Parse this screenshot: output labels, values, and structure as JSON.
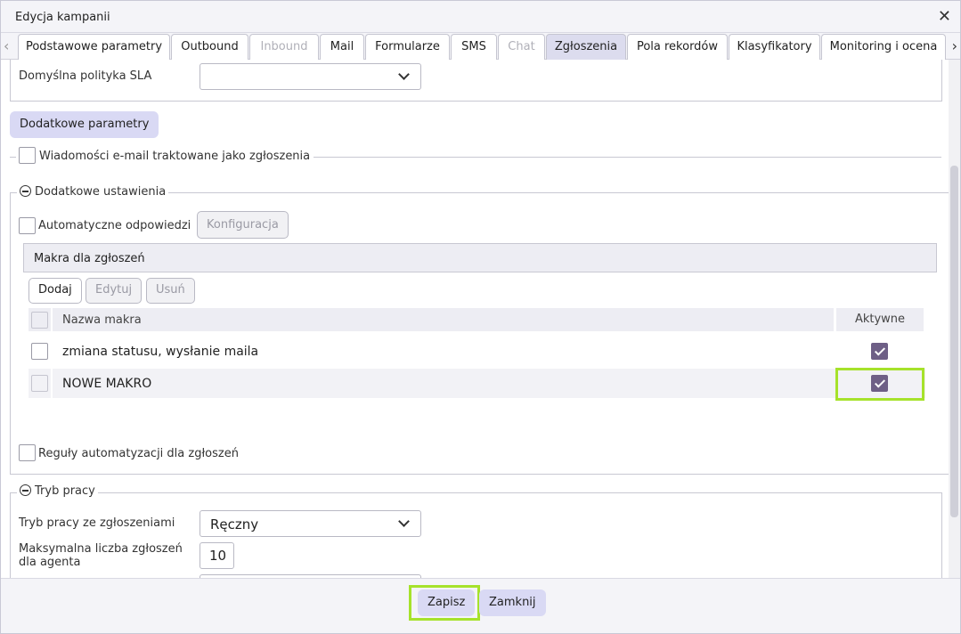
{
  "dialog": {
    "title": "Edycja kampanii"
  },
  "tabs": [
    {
      "label": "Podstawowe parametry",
      "state": "normal"
    },
    {
      "label": "Outbound",
      "state": "normal"
    },
    {
      "label": "Inbound",
      "state": "disabled"
    },
    {
      "label": "Mail",
      "state": "normal"
    },
    {
      "label": "Formularze",
      "state": "normal"
    },
    {
      "label": "SMS",
      "state": "normal"
    },
    {
      "label": "Chat",
      "state": "disabled"
    },
    {
      "label": "Zgłoszenia",
      "state": "active"
    },
    {
      "label": "Pola rekordów",
      "state": "normal"
    },
    {
      "label": "Klasyfikatory",
      "state": "normal"
    },
    {
      "label": "Monitoring i ocena",
      "state": "normal"
    }
  ],
  "sla": {
    "label": "Domyślna polityka SLA",
    "value": ""
  },
  "extra_params_button": "Dodatkowe parametry",
  "email_as_tickets": {
    "label": "Wiadomości e-mail traktowane jako zgłoszenia",
    "checked": false
  },
  "additional_settings": {
    "legend": "Dodatkowe ustawienia",
    "auto_replies": {
      "label": "Automatyczne odpowiedzi",
      "checked": false
    },
    "config_button": "Konfiguracja",
    "macros": {
      "header": "Makra dla zgłoszeń",
      "buttons": {
        "add": "Dodaj",
        "edit": "Edytuj",
        "remove": "Usuń"
      },
      "columns": {
        "name": "Nazwa makra",
        "active": "Aktywne"
      },
      "rows": [
        {
          "name": "zmiana statusu, wysłanie maila",
          "active": true
        },
        {
          "name": "NOWE MAKRO",
          "active": true
        }
      ]
    },
    "automation_rules": {
      "label": "Reguły automatyzacji dla zgłoszeń",
      "checked": false
    }
  },
  "work_mode": {
    "legend": "Tryb pracy",
    "mode_label": "Tryb pracy ze zgłoszeniami",
    "mode_value": "Ręczny",
    "max_tickets_label": "Maksymalna liczba zgłoszeń dla agenta",
    "max_tickets_value": "10"
  },
  "footer": {
    "save": "Zapisz",
    "close": "Zamknij"
  },
  "colors": {
    "accent": "#d9d9f4",
    "checkbox_checked": "#6e5f86",
    "highlight": "#a6e22b"
  }
}
